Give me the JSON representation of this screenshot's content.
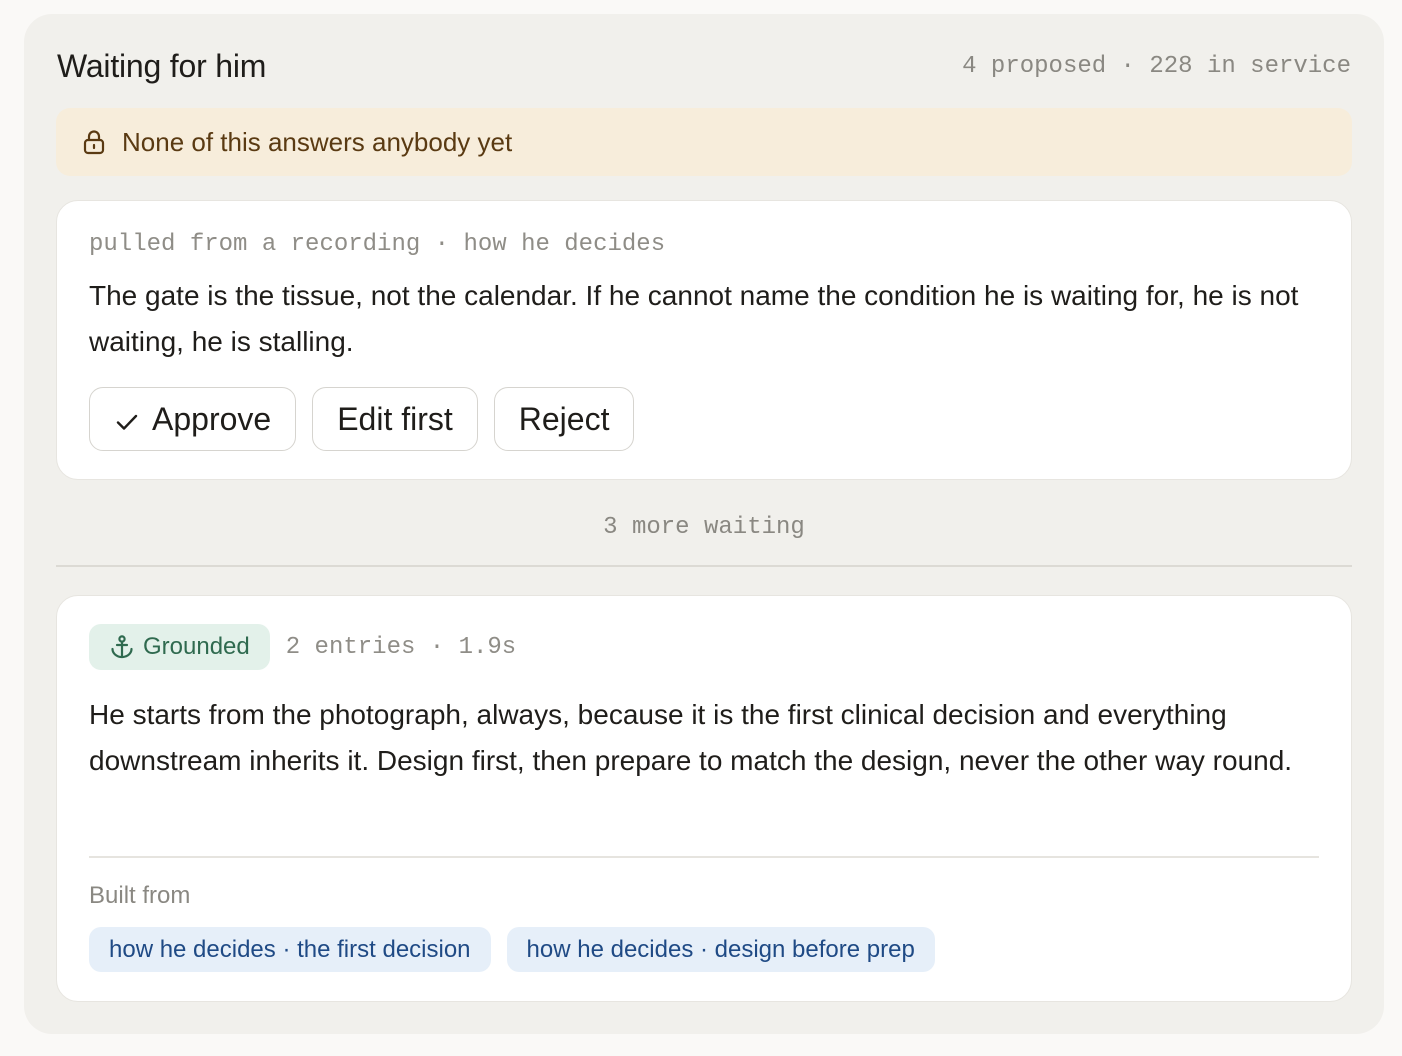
{
  "header": {
    "title": "Waiting for him",
    "counts": "4 proposed · 228 in service"
  },
  "notice": {
    "icon": "lock-icon",
    "text": "None of this answers anybody yet"
  },
  "proposal": {
    "meta": "pulled from a recording · how he decides",
    "text": "The gate is the tissue, not the calendar. If he cannot name the condition he is waiting for, he is not waiting, he is stalling.",
    "actions": {
      "approve": "Approve",
      "edit": "Edit first",
      "reject": "Reject"
    }
  },
  "queue": {
    "more_waiting": "3 more waiting"
  },
  "answer": {
    "badge": {
      "label": "Grounded",
      "icon": "anchor-icon",
      "color": "#2f6a4f"
    },
    "meta": "2 entries · 1.9s",
    "text": "He starts from the photograph, always, because it is the first clinical decision and everything downstream inherits it. Design first, then prepare to match the design, never the other way round.",
    "built_from_label": "Built from",
    "sources": [
      "how he decides · the first decision",
      "how he decides · design before prep"
    ]
  },
  "colors": {
    "panel_bg": "#f1f0ec",
    "notice_bg": "#f7eddb",
    "grounded_bg": "#e3f1ea",
    "source_chip_bg": "#e6eff9",
    "source_chip_text": "#1f4a85"
  }
}
